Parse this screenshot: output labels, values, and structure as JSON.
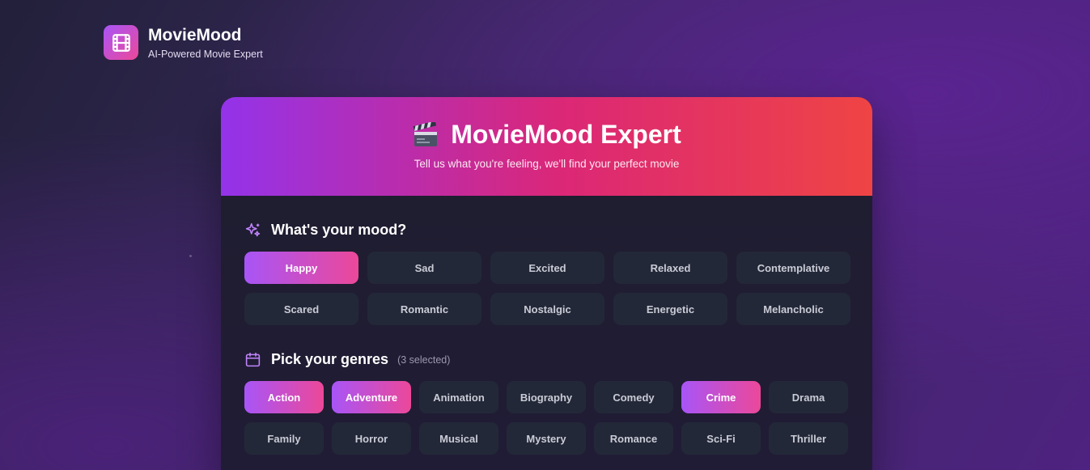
{
  "brand": {
    "name": "MovieMood",
    "tagline": "AI-Powered Movie Expert",
    "logo_icon": "film-icon"
  },
  "hero": {
    "icon": "clapperboard-icon",
    "title": "MovieMood Expert",
    "subtitle": "Tell us what you're feeling, we'll find your perfect movie"
  },
  "mood": {
    "icon": "sparkles-icon",
    "title": "What's your mood?",
    "options": [
      {
        "label": "Happy",
        "selected": true
      },
      {
        "label": "Sad",
        "selected": false
      },
      {
        "label": "Excited",
        "selected": false
      },
      {
        "label": "Relaxed",
        "selected": false
      },
      {
        "label": "Contemplative",
        "selected": false
      },
      {
        "label": "Scared",
        "selected": false
      },
      {
        "label": "Romantic",
        "selected": false
      },
      {
        "label": "Nostalgic",
        "selected": false
      },
      {
        "label": "Energetic",
        "selected": false
      },
      {
        "label": "Melancholic",
        "selected": false
      }
    ]
  },
  "genres": {
    "icon": "calendar-icon",
    "title": "Pick your genres",
    "count_label": "(3 selected)",
    "options": [
      {
        "label": "Action",
        "selected": true
      },
      {
        "label": "Adventure",
        "selected": true
      },
      {
        "label": "Animation",
        "selected": false
      },
      {
        "label": "Biography",
        "selected": false
      },
      {
        "label": "Comedy",
        "selected": false
      },
      {
        "label": "Crime",
        "selected": true
      },
      {
        "label": "Drama",
        "selected": false
      },
      {
        "label": "Family",
        "selected": false
      },
      {
        "label": "Horror",
        "selected": false
      },
      {
        "label": "Musical",
        "selected": false
      },
      {
        "label": "Mystery",
        "selected": false
      },
      {
        "label": "Romance",
        "selected": false
      },
      {
        "label": "Sci-Fi",
        "selected": false
      },
      {
        "label": "Thriller",
        "selected": false
      }
    ]
  },
  "colors": {
    "accent_start": "#a855f7",
    "accent_end": "#ec4899",
    "header_end": "#ef4444",
    "chip_bg": "#232838"
  }
}
